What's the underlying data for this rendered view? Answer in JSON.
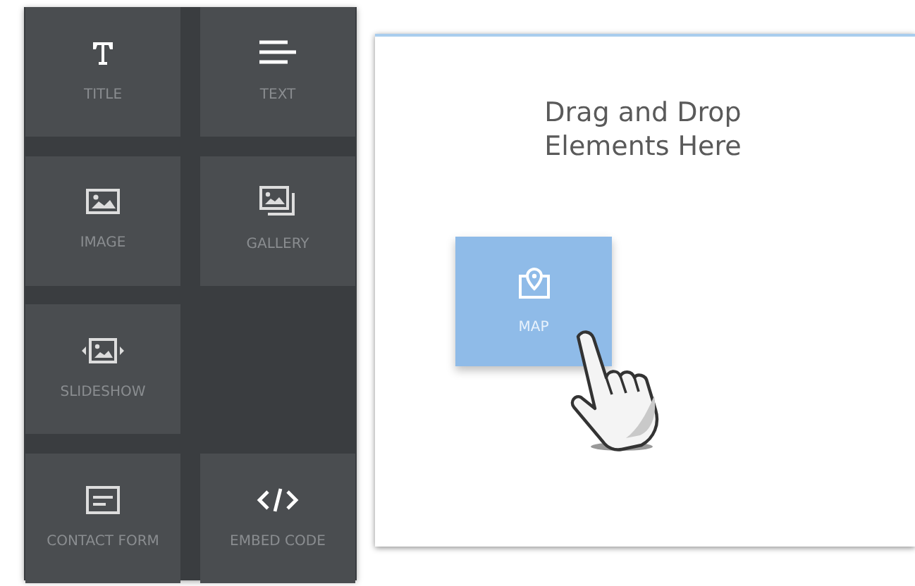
{
  "palette": {
    "rows": [
      [
        {
          "label": "TITLE",
          "kind": "title"
        },
        {
          "label": "TEXT",
          "kind": "text"
        }
      ],
      [
        {
          "label": "IMAGE",
          "kind": "image"
        },
        {
          "label": "GALLERY",
          "kind": "gallery"
        }
      ],
      [
        {
          "label": "SLIDESHOW",
          "kind": "slideshow"
        }
      ],
      [
        {
          "label": "CONTACT FORM",
          "kind": "form"
        },
        {
          "label": "EMBED CODE",
          "kind": "code"
        }
      ]
    ]
  },
  "canvas": {
    "heading": "Drag and Drop Elements Here",
    "dragged_tile": {
      "label": "MAP",
      "kind": "map"
    }
  }
}
